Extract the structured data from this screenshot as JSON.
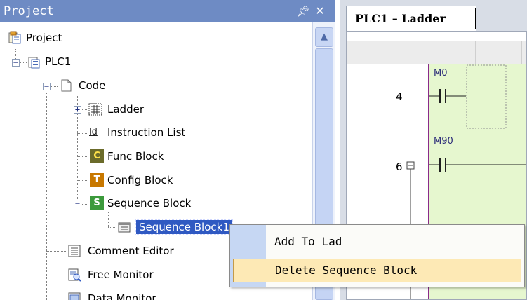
{
  "project_panel": {
    "title": "Project",
    "pin_icon": "pin-icon",
    "close_icon": "close-icon"
  },
  "tree": {
    "root": "Project",
    "plc": "PLC1",
    "code": "Code",
    "ladder": "Ladder",
    "instruction_list": "Instruction List",
    "instruction_list_icon_text": "ld",
    "func_block": "Func Block",
    "func_block_icon_letter": "C",
    "config_block": "Config Block",
    "config_block_icon_letter": "T",
    "sequence_block": "Sequence Block",
    "sequence_block_icon_letter": "S",
    "sequence_block_child": "Sequence Block1",
    "comment_editor": "Comment Editor",
    "free_monitor": "Free Monitor",
    "data_monitor": "Data Monitor"
  },
  "ladder_editor": {
    "tab_label": "PLC1 – Ladder",
    "rows": [
      {
        "number": "4",
        "contact": "M0"
      },
      {
        "number": "6",
        "contact": "M90"
      }
    ],
    "green_color": "#e6f7cf"
  },
  "context_menu": {
    "items": [
      {
        "label": "Add To Lad"
      },
      {
        "label": "Delete Sequence Block"
      }
    ],
    "hover_color": "#fde9b5"
  },
  "colors": {
    "panel_header": "#6e8bc4",
    "selection": "#2f59c2"
  }
}
